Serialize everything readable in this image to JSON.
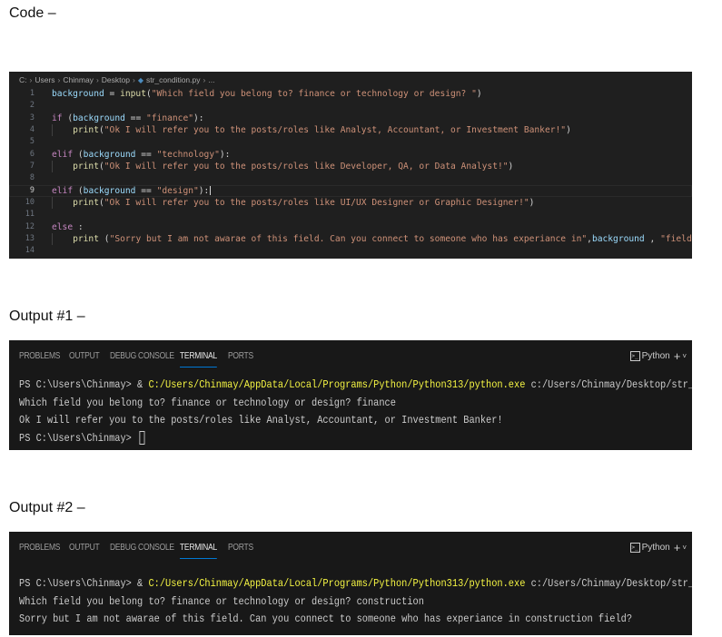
{
  "labels": {
    "code": "Code –",
    "output1": "Output #1 –",
    "output2": "Output #2 –"
  },
  "editor": {
    "breadcrumb": [
      "C:",
      "Users",
      "Chinmay",
      "Desktop",
      "str_condition.py",
      "..."
    ],
    "active_line": 9,
    "line_numbers": [
      "1",
      "2",
      "3",
      "4",
      "5",
      "6",
      "7",
      "8",
      "9",
      "10",
      "11",
      "12",
      "13",
      "14"
    ]
  },
  "panel": {
    "tabs": [
      "PROBLEMS",
      "OUTPUT",
      "DEBUG CONSOLE",
      "TERMINAL",
      "PORTS"
    ],
    "active_tab": "TERMINAL",
    "shell_label": "Python",
    "new_terminal": "+",
    "more": "˅"
  },
  "terminal1": {
    "prompt": "PS C:\\Users\\Chinmay> & ",
    "python_path": "C:/Users/Chinmay/AppData/Local/Programs/Python/Python313/python.exe",
    "script_path": " c:/Users/Chinmay/Desktop/str_condition.py",
    "line2": "Which field you belong to? finance or technology or design? finance",
    "line3": "Ok I will refer you to the posts/roles like Analyst, Accountant, or Investment Banker!",
    "line4": "PS C:\\Users\\Chinmay> "
  },
  "terminal2": {
    "prompt": "PS C:\\Users\\Chinmay> & ",
    "python_path": "C:/Users/Chinmay/AppData/Local/Programs/Python/Python313/python.exe",
    "script_path": " c:/Users/Chinmay/Desktop/str_condition.py",
    "line2": "Which field you belong to? finance or technology or design? construction",
    "line3": "Sorry but I am not awarae of this field. Can you connect to someone who has experiance in construction field?"
  }
}
